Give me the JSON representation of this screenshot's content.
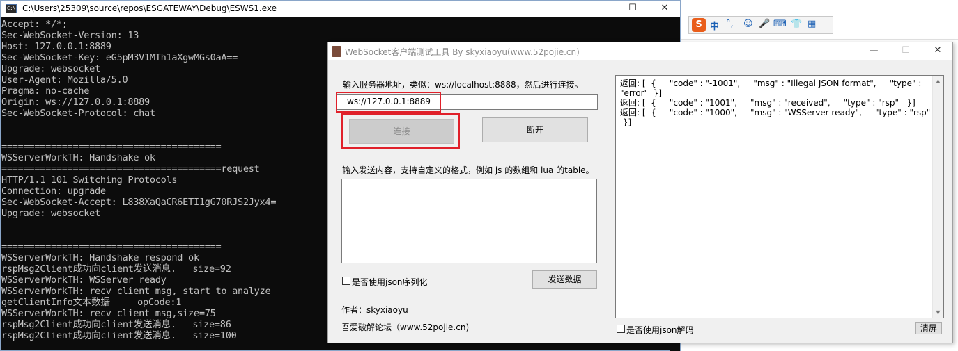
{
  "console": {
    "title": "C:\\Users\\25309\\source\\repos\\ESGATEWAY\\Debug\\ESWS1.exe",
    "icon": "console-icon",
    "lines": [
      "Accept: */*;",
      "Sec-WebSocket-Version: 13",
      "Host: 127.0.0.1:8889",
      "Sec-WebSocket-Key: eG5pM3V1MTh1aXgwMGs0aA==",
      "Upgrade: websocket",
      "User-Agent: Mozilla/5.0",
      "Pragma: no-cache",
      "Origin: ws://127.0.0.1:8889",
      "Sec-WebSocket-Protocol: chat",
      "",
      "",
      "========================================",
      "WSServerWorkTH: Handshake ok",
      "========================================request",
      "HTTP/1.1 101 Switching Protocols",
      "Connection: upgrade",
      "Sec-WebSocket-Accept: L838XaQaCR6ETI1gG70RJS2Jyx4=",
      "Upgrade: websocket",
      "",
      "",
      "========================================",
      "WSServerWorkTH: Handshake respond ok",
      "rspMsg2Client成功向client发送消息.   size=92",
      "WSServerWorkTH: WSServer ready",
      "WSServerWorkTH: recv client msg, start to analyze",
      "getClientInfo文本数据     opCode:1",
      "WSServerWorkTH: recv client msg,size=75",
      "rspMsg2Client成功向client发送消息.   size=86",
      "rspMsg2Client成功向client发送消息.   size=100"
    ],
    "text_color": "#c0c0c0",
    "background": "#0c0c0c"
  },
  "ime_toolbar": {
    "logo": "S",
    "mode": "中",
    "punct": "°,",
    "icons": [
      "emoji-icon",
      "microphone-icon",
      "keyboard-icon",
      "skin-icon",
      "toolbox-icon"
    ]
  },
  "ws_dialog": {
    "title": "WebSocket客户端测试工具 By skyxiaoyu(www.52pojie.cn)",
    "server_label": "输入服务器地址，类似：ws://localhost:8888，然后进行连接。",
    "server_value": "ws://127.0.0.1:8889",
    "connect_label": "连接",
    "disconnect_label": "断开",
    "send_label": "输入发送内容，支持自定义的格式，例如 js 的数组和 lua 的table。",
    "send_value": "",
    "json_serialize_label": "是否使用json序列化",
    "send_button_label": "发送数据",
    "author": "作者：skyxiaoyu",
    "forum": "吾爱破解论坛（www.52pojie.cn)",
    "response_lines": [
      "返回: [  {     \"code\" : \"-1001\",     \"msg\" : \"Illegal JSON format\",     \"type\" :",
      "\"error\"  }]",
      "返回: [  {     \"code\" : \"1001\",     \"msg\" : \"received\",     \"type\" : \"rsp\"   }]",
      "返回: [  {     \"code\" : \"1000\",     \"msg\" : \"WSServer ready\",     \"type\" : \"rsp\"",
      " }]"
    ],
    "json_decode_label": "是否使用json解码",
    "clear_label": "清屏",
    "highlight_color": "#e0202a"
  }
}
